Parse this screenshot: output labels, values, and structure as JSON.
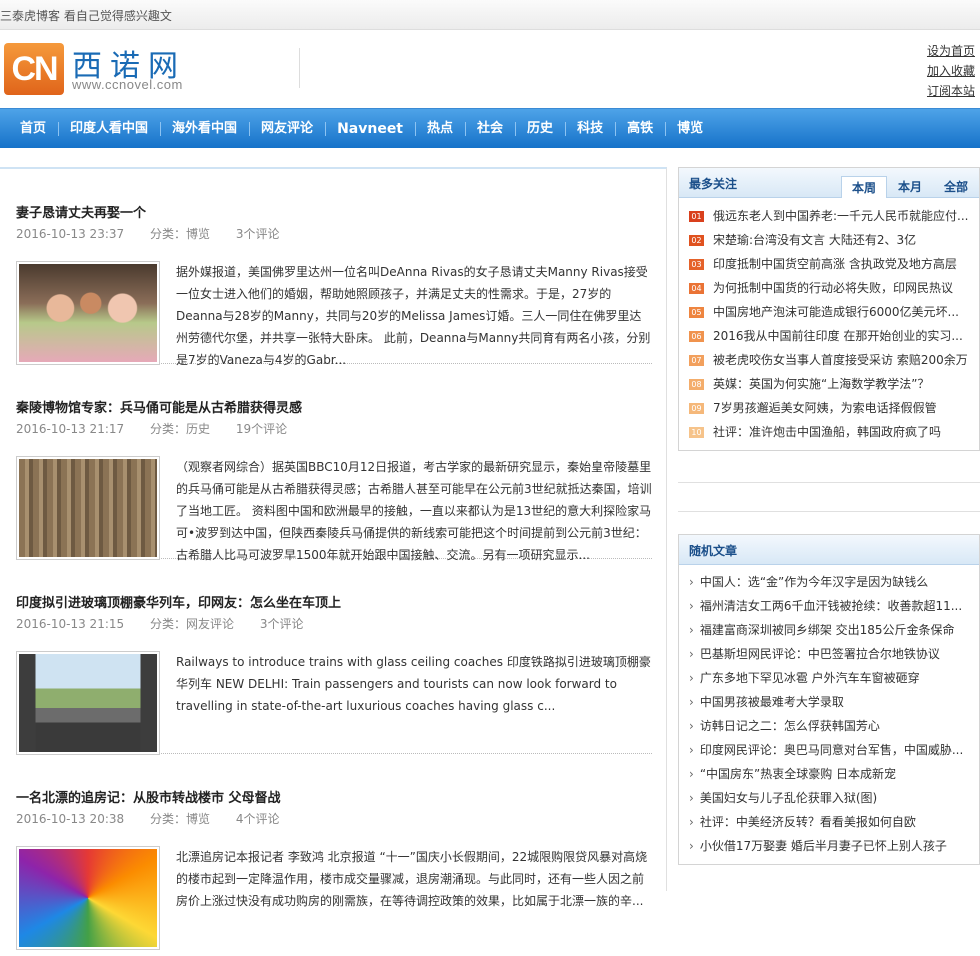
{
  "topbar": {
    "text": "三泰虎博客 看自己觉得感兴趣文"
  },
  "logo": {
    "box": "CN",
    "cn": "西诺网",
    "en": "www.ccnovel.com"
  },
  "toplinks": [
    "设为首页",
    "加入收藏",
    "订阅本站"
  ],
  "nav": [
    "首页",
    "印度人看中国",
    "海外看中国",
    "网友评论",
    "Navneet",
    "热点",
    "社会",
    "历史",
    "科技",
    "高铁",
    "博览"
  ],
  "posts": [
    {
      "title": "妻子恳请丈夫再娶一个",
      "date": "2016-10-13 23:37",
      "category": "分类：博览",
      "comments": "3个评论",
      "excerpt": "据外媒报道，美国佛罗里达州一位名叫DeAnna Rivas的女子恳请丈夫Manny Rivas接受一位女士进入他们的婚姻，帮助她照顾孩子，并满足丈夫的性需求。于是，27岁的Deanna与28岁的Manny，共同与20岁的Melissa James订婚。三人一同住在佛罗里达州劳德代尔堡，并共享一张特大卧床。 此前，Deanna与Manny共同育有两名小孩，分别是7岁的Vaneza与4岁的Gabr..."
    },
    {
      "title": "秦陵博物馆专家：兵马俑可能是从古希腊获得灵感",
      "date": "2016-10-13 21:17",
      "category": "分类：历史",
      "comments": "19个评论",
      "excerpt": "（观察者网综合）据英国BBC10月12日报道，考古学家的最新研究显示，秦始皇帝陵墓里的兵马俑可能是从古希腊获得灵感；古希腊人甚至可能早在公元前3世纪就抵达秦国，培训了当地工匠。 资料图中国和欧洲最早的接触，一直以来都认为是13世纪的意大利探险家马可•波罗到达中国，但陕西秦陵兵马俑提供的新线索可能把这个时间提前到公元前3世纪：古希腊人比马可波罗早1500年就开始跟中国接触、交流。另有一项研究显示..."
    },
    {
      "title": "印度拟引进玻璃顶棚豪华列车，印网友：怎么坐在车顶上",
      "date": "2016-10-13 21:15",
      "category": "分类：网友评论",
      "comments": "3个评论",
      "excerpt": "Railways to introduce trains with glass ceiling coaches 印度铁路拟引进玻璃顶棚豪华列车 NEW DELHI: Train passengers and tourists can now look forward to travelling in state-of-the-art luxurious coaches having glass c..."
    },
    {
      "title": "一名北漂的追房记：从股市转战楼市 父母督战",
      "date": "2016-10-13 20:38",
      "category": "分类：博览",
      "comments": "4个评论",
      "excerpt": "北漂追房记本报记者 李致鸿 北京报道 “十一”国庆小长假期间，22城限购限贷风暴对高烧的楼市起到一定降温作用，楼市成交量骤减，退房潮涌现。与此同时，还有一些人因之前房价上涨过快没有成功购房的刚需族，在等待调控政策的效果，比如属于北漂一族的辛..."
    }
  ],
  "hot": {
    "title": "最多关注",
    "tabs": [
      "本周",
      "本月",
      "全部"
    ],
    "items": [
      {
        "num": "01",
        "text": "俄远东老人到中国养老:一千元人民币就能应付..."
      },
      {
        "num": "02",
        "text": "宋楚瑜:台湾没有文言 大陆还有2、3亿"
      },
      {
        "num": "03",
        "text": "印度抵制中国货空前高涨 含执政党及地方高层"
      },
      {
        "num": "04",
        "text": "为何抵制中国货的行动必将失败，印网民热议"
      },
      {
        "num": "05",
        "text": "中国房地产泡沫可能造成银行6000亿美元坏..."
      },
      {
        "num": "06",
        "text": "2016我从中国前往印度 在那开始创业的实习..."
      },
      {
        "num": "07",
        "text": "被老虎咬伤女当事人首度接受采访 索赔200余万"
      },
      {
        "num": "08",
        "text": "英媒：英国为何实施“上海数学教学法”？"
      },
      {
        "num": "09",
        "text": "7岁男孩邂逅美女阿姨，为索电话择假假管"
      },
      {
        "num": "10",
        "text": "社评：准许炮击中国渔船，韩国政府疯了吗"
      }
    ]
  },
  "random": {
    "title": "随机文章",
    "items": [
      "中国人：选“金”作为今年汉字是因为缺钱么",
      "福州清洁女工两6千血汗钱被抢续：收善款超11...",
      "福建富商深圳被同乡绑架 交出185公斤金条保命",
      "巴基斯坦网民评论：中巴签署拉合尔地铁协议",
      "广东多地下罕见冰雹 户外汽车车窗被砸穿",
      "中国男孩被最难考大学录取",
      "访韩日记之二：怎么俘获韩国芳心",
      "印度网民评论：奥巴马同意对台军售，中国威胁...",
      "“中国房东”热衷全球豪购 日本成新宠",
      "美国妇女与儿子乱伦获罪入狱(图)",
      "社评：中美经济反转？看看美报如何自欧",
      "小伙借17万娶妻 婚后半月妻子已怀上别人孩子"
    ]
  },
  "colors": {
    "nav_top": "#4ea3e8",
    "nav_bottom": "#1672c9",
    "num_colors": [
      "#d9401d",
      "#e0521f",
      "#e5622a",
      "#ea7335",
      "#ee8540",
      "#f0934e",
      "#f2a05d",
      "#f4ad6b",
      "#f5b87a",
      "#f6c38a"
    ]
  }
}
